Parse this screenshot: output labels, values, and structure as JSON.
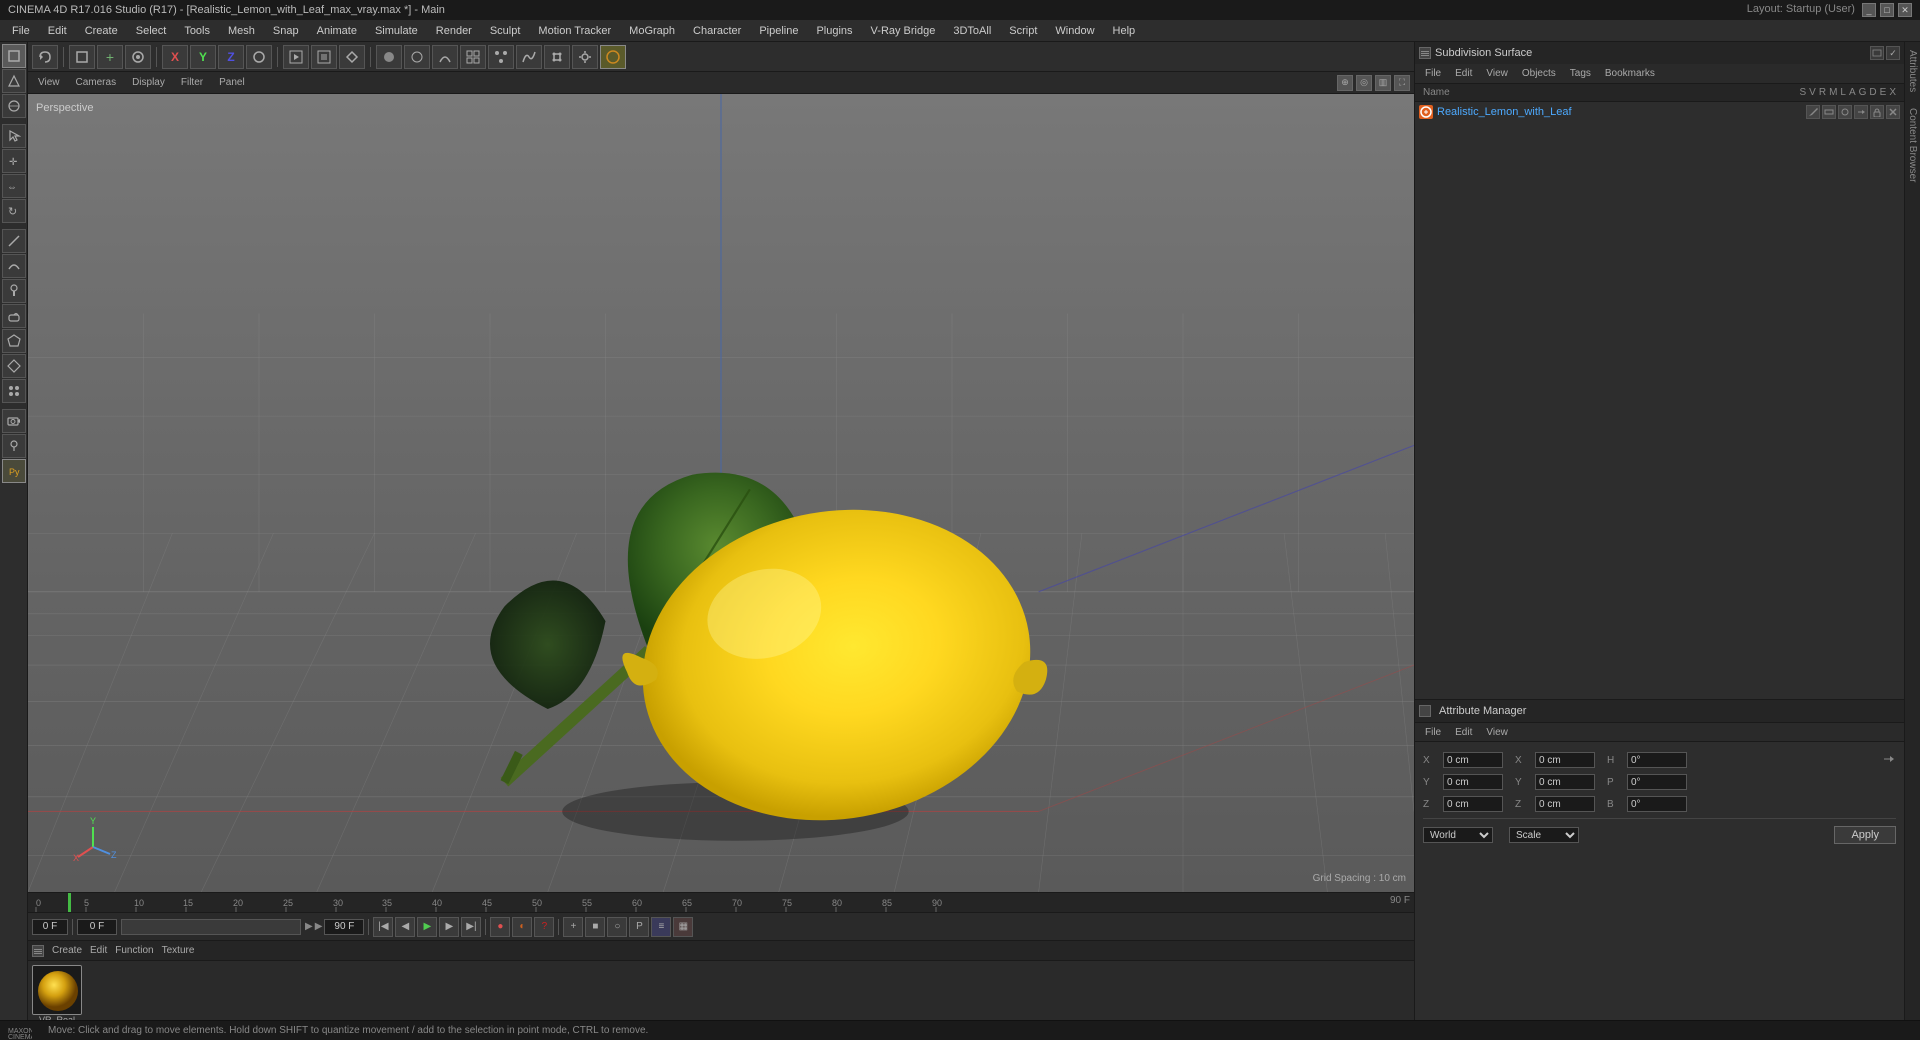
{
  "titlebar": {
    "title": "CINEMA 4D R17.016 Studio (R17) - [Realistic_Lemon_with_Leaf_max_vray.max *] - Main",
    "layout_label": "Layout:",
    "layout_value": "Startup (User)"
  },
  "menubar": {
    "items": [
      "File",
      "Edit",
      "Create",
      "Select",
      "Tools",
      "Mesh",
      "Snap",
      "Animate",
      "Simulate",
      "Render",
      "Sculpt",
      "Motion Tracker",
      "MoGraph",
      "Character",
      "Pipeline",
      "Plugins",
      "V-Ray Bridge",
      "3DToAll",
      "Script",
      "Window",
      "Help"
    ]
  },
  "viewport": {
    "label": "Perspective",
    "grid_spacing": "Grid Spacing : 10 cm",
    "controls": [
      "View",
      "Cameras",
      "Display",
      "Filter",
      "Panel"
    ]
  },
  "object_manager": {
    "title": "Subdivision Surface",
    "columns": [
      "Name",
      "S",
      "V",
      "R",
      "M",
      "L",
      "A",
      "G",
      "D",
      "E",
      "X"
    ],
    "items": [
      {
        "name": "Realistic_Lemon_with_Leaf",
        "color": "#e06020"
      }
    ]
  },
  "attr_manager": {
    "x_pos": "0 cm",
    "y_pos": "0 cm",
    "z_pos": "0 cm",
    "x_rot": "0 cm",
    "y_rot": "0 cm",
    "z_rot": "0 cm",
    "h_val": "0°",
    "p_val": "0°",
    "b_val": "0°",
    "coord_mode": "World",
    "scale_mode": "Scale",
    "apply_label": "Apply"
  },
  "timeline": {
    "current_frame": "0 F",
    "start_frame": "0 F",
    "end_frame": "90 F",
    "frame_rate": "0 F",
    "ruler_marks": [
      "0",
      "5",
      "10",
      "15",
      "20",
      "25",
      "30",
      "35",
      "40",
      "45",
      "50",
      "55",
      "60",
      "65",
      "70",
      "75",
      "80",
      "85",
      "90"
    ]
  },
  "material": {
    "name": "VR_Real",
    "menu_items": [
      "Create",
      "Edit",
      "Function",
      "Texture"
    ]
  },
  "status_bar": {
    "text": "Move: Click and drag to move elements. Hold down SHIFT to quantize movement / add to the selection in point mode, CTRL to remove."
  },
  "icons": {
    "undo": "↩",
    "redo": "↪",
    "new": "+",
    "open": "📁",
    "save": "💾",
    "render": "▶",
    "play": "▶",
    "stop": "■",
    "rewind": "◀",
    "forward": "▶",
    "select": "↖",
    "move": "✛",
    "scale": "⇔",
    "rotate": "↻"
  },
  "sidebar_right": {
    "tabs": [
      "Attributes",
      "Content Browser"
    ]
  }
}
